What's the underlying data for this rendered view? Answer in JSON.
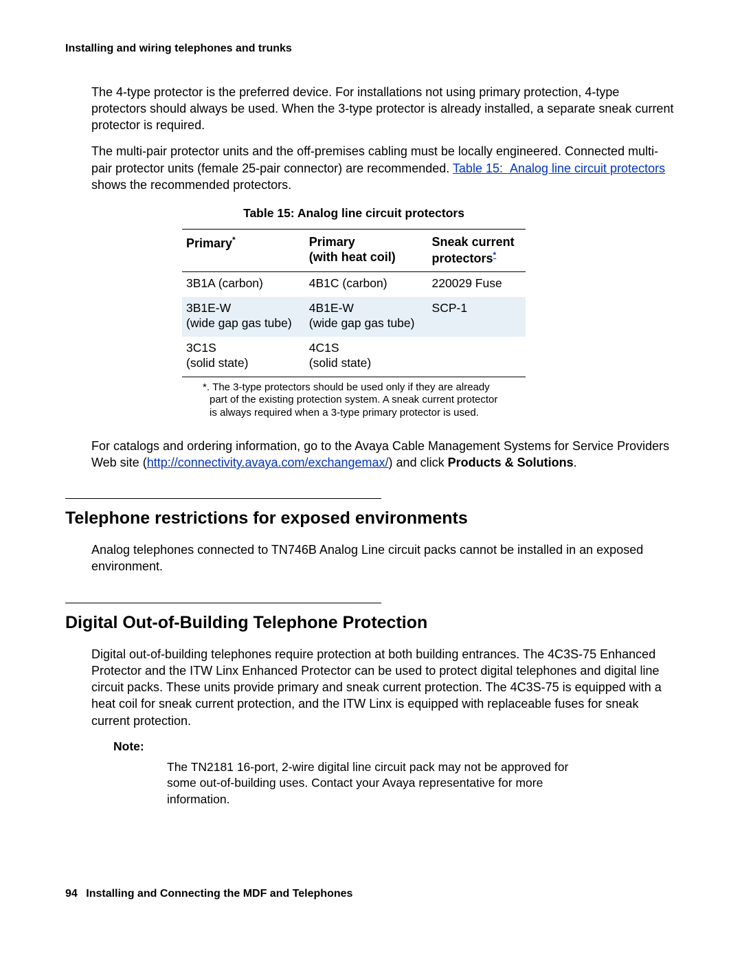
{
  "running_head": "Installing and wiring telephones and trunks",
  "para1": "The 4-type protector is the preferred device. For installations not using primary protection, 4-type protectors should always be used. When the 3-type protector is already installed, a separate sneak current protector is required.",
  "para2a": "The multi-pair protector units and the off-premises cabling must be locally engineered. Connected multi-pair protector units (female 25-pair connector) are recommended. ",
  "para2_link": "Table 15:  Analog line circuit protectors",
  "para2b": " shows the recommended protectors.",
  "table": {
    "title": "Table 15: Analog line circuit protectors",
    "headers": {
      "c1": "Primary",
      "c2a": "Primary",
      "c2b": "(with heat coil)",
      "c3a": "Sneak current",
      "c3b": "protectors"
    },
    "rows": [
      {
        "c1a": "3B1A (carbon)",
        "c1b": "",
        "c2a": "4B1C (carbon)",
        "c2b": "",
        "c3": "220029 Fuse"
      },
      {
        "c1a": "3B1E-W",
        "c1b": "(wide gap gas tube)",
        "c2a": "4B1E-W",
        "c2b": "(wide gap gas tube)",
        "c3": "SCP-1"
      },
      {
        "c1a": "3C1S",
        "c1b": "(solid state)",
        "c2a": "4C1S",
        "c2b": "(solid state)",
        "c3": ""
      }
    ],
    "footnote_marker": "*",
    "footnote": "*. The 3-type protectors should be used only if they are already part of the existing protection system. A sneak current protector is always required when a 3-type primary protector is used."
  },
  "para3a": "For catalogs and ordering information, go to the Avaya Cable Management Systems for Service Providers Web site (",
  "para3_link": "http://connectivity.avaya.com/exchangemax/",
  "para3b": ") and click ",
  "para3_bold": "Products & Solutions",
  "para3c": ".",
  "section1_title": "Telephone restrictions for exposed environments",
  "section1_body": "Analog telephones connected to TN746B Analog Line circuit packs cannot be installed in an exposed environment.",
  "section2_title": "Digital Out-of-Building Telephone Protection",
  "section2_body": "Digital out-of-building telephones require protection at both building entrances. The 4C3S-75 Enhanced Protector and the ITW Linx Enhanced Protector can be used to protect digital telephones and digital line circuit packs. These units provide primary and sneak current protection. The 4C3S-75 is equipped with a heat coil for sneak current protection, and the ITW Linx is equipped with replaceable fuses for sneak current protection.",
  "note_label": "Note:",
  "note_body": "The TN2181 16-port, 2-wire digital line circuit pack may not be approved for some out-of-building uses. Contact your Avaya representative for more information.",
  "footer": {
    "page_number": "94",
    "title": "Installing and Connecting the MDF and Telephones"
  }
}
